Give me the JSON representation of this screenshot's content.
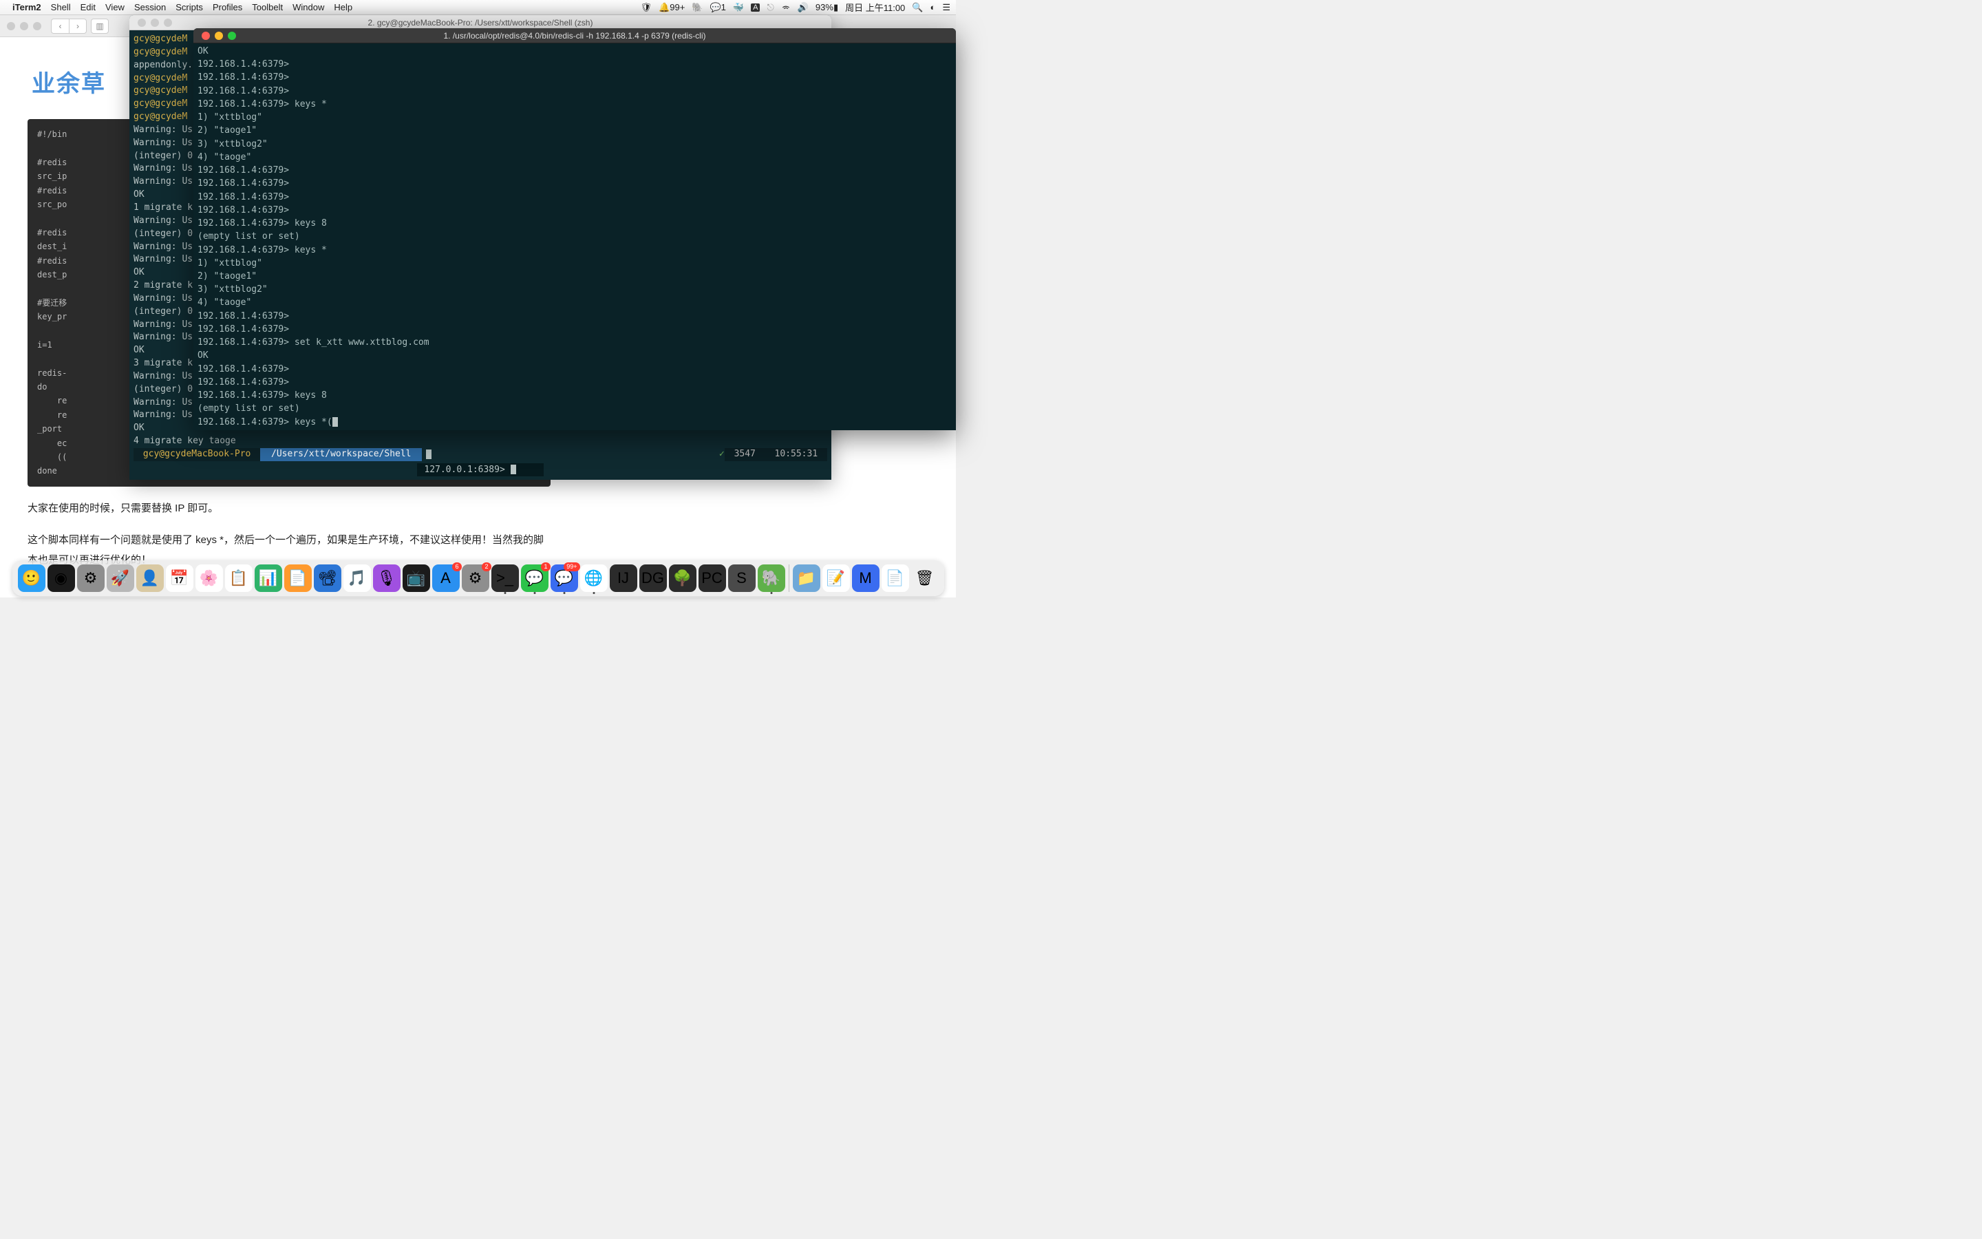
{
  "menubar": {
    "app": "iTerm2",
    "items": [
      "Shell",
      "Edit",
      "View",
      "Session",
      "Scripts",
      "Profiles",
      "Toolbelt",
      "Window",
      "Help"
    ],
    "status": {
      "notif": "99+",
      "wechat": "1",
      "battery": "93%",
      "datetime": "周日 上午11:00"
    }
  },
  "browser": {
    "logo": "业余草",
    "code_lines": [
      "#!/bin",
      "",
      "#redis",
      "src_ip",
      "#redis",
      "src_po",
      "",
      "#redis",
      "dest_i",
      "#redis",
      "dest_p",
      "",
      "#要迁移",
      "key_pr",
      "",
      "i=1",
      "",
      "redis-",
      "do",
      "    re",
      "    re",
      "_port ",
      "    ec",
      "    ((",
      "done"
    ],
    "para1": "大家在使用的时候，只需要替换 IP 即可。",
    "para2": "这个脚本同样有一个问题就是使用了 keys *，然后一个一个遍历，如果是生产环境，不建议这样使用！当然我的脚本也是可以再进行优化的！"
  },
  "term1": {
    "title": "2. gcy@gcydeMacBook-Pro: /Users/xtt/workspace/Shell (zsh)",
    "prompt_user": "gcy@gcydeM",
    "left_lines": [
      "gcy@gcydeM",
      "gcy@gcydeM",
      "appendonly.",
      "gcy@gcydeM",
      "gcy@gcydeM",
      "gcy@gcydeM",
      "gcy@gcydeM",
      "Warning: Us",
      "Warning: Us",
      "(integer) 0",
      "Warning: Us",
      "Warning: Us",
      "OK",
      "1 migrate k",
      "Warning: Us",
      "(integer) 0",
      "Warning: Us",
      "Warning: Us",
      "OK",
      "2 migrate k",
      "Warning: Us",
      "(integer) 0",
      "Warning: Us",
      "Warning: Us",
      "OK",
      "3 migrate k",
      "Warning: Us",
      "(integer) 0",
      "Warning: Us",
      "Warning: Us",
      "OK",
      "4 migrate key taoge"
    ],
    "bottom_prompt_user": "gcy@gcydeMacBook-Pro",
    "bottom_prompt_path": "/Users/xtt/workspace/Shell",
    "right_num": "3547",
    "right_time": "10:55:31",
    "local_prompt": "127.0.0.1:6389> "
  },
  "term2": {
    "title": "1. /usr/local/opt/redis@4.0/bin/redis-cli -h 192.168.1.4 -p 6379 (redis-cli)",
    "lines": [
      "OK",
      "192.168.1.4:6379>",
      "192.168.1.4:6379>",
      "192.168.1.4:6379>",
      "192.168.1.4:6379> keys *",
      "1) \"xttblog\"",
      "2) \"taoge1\"",
      "3) \"xttblog2\"",
      "4) \"taoge\"",
      "192.168.1.4:6379>",
      "192.168.1.4:6379>",
      "192.168.1.4:6379>",
      "192.168.1.4:6379>",
      "192.168.1.4:6379> keys 8",
      "(empty list or set)",
      "192.168.1.4:6379> keys *",
      "1) \"xttblog\"",
      "2) \"taoge1\"",
      "3) \"xttblog2\"",
      "4) \"taoge\"",
      "192.168.1.4:6379>",
      "192.168.1.4:6379>",
      "192.168.1.4:6379> set k_xtt www.xttblog.com",
      "OK",
      "192.168.1.4:6379>",
      "192.168.1.4:6379>",
      "192.168.1.4:6379> keys 8",
      "(empty list or set)",
      "192.168.1.4:6379> keys *("
    ]
  },
  "dock": {
    "apps": [
      {
        "name": "finder",
        "bg": "#2aa0f5",
        "glyph": "🙂"
      },
      {
        "name": "siri",
        "bg": "#1b1b1b",
        "glyph": "◉"
      },
      {
        "name": "sysprefs",
        "bg": "#8e8e8e",
        "glyph": "⚙"
      },
      {
        "name": "launchpad",
        "bg": "#b8b8b8",
        "glyph": "🚀"
      },
      {
        "name": "contacts",
        "bg": "#d9c9a3",
        "glyph": "👤"
      },
      {
        "name": "calendar",
        "bg": "#ffffff",
        "glyph": "📅"
      },
      {
        "name": "photos",
        "bg": "#ffffff",
        "glyph": "🌸"
      },
      {
        "name": "reminders",
        "bg": "#ffffff",
        "glyph": "📋"
      },
      {
        "name": "numbers",
        "bg": "#2fb36a",
        "glyph": "📊"
      },
      {
        "name": "pages",
        "bg": "#ff9a2e",
        "glyph": "📄"
      },
      {
        "name": "keynote",
        "bg": "#2c76d6",
        "glyph": "📽"
      },
      {
        "name": "music",
        "bg": "#ffffff",
        "glyph": "🎵"
      },
      {
        "name": "podcasts",
        "bg": "#a050e0",
        "glyph": "🎙"
      },
      {
        "name": "tv",
        "bg": "#1b1b1b",
        "glyph": "📺"
      },
      {
        "name": "appstore",
        "bg": "#2a90f0",
        "glyph": "A",
        "badge": "6"
      },
      {
        "name": "sysprefs2",
        "bg": "#8e8e8e",
        "glyph": "⚙",
        "badge": "2"
      },
      {
        "name": "iterm",
        "bg": "#2b2b2b",
        "glyph": ">_",
        "dot": true
      },
      {
        "name": "wechat",
        "bg": "#2dc24a",
        "glyph": "💬",
        "badge": "1",
        "dot": true
      },
      {
        "name": "wechatwork",
        "bg": "#3a6cf0",
        "glyph": "💬",
        "badge": "99+",
        "dot": true
      },
      {
        "name": "chrome",
        "bg": "#ffffff",
        "glyph": "🌐",
        "dot": true
      },
      {
        "name": "intellij",
        "bg": "#2b2b2b",
        "glyph": "IJ"
      },
      {
        "name": "datagrip",
        "bg": "#2b2b2b",
        "glyph": "DG"
      },
      {
        "name": "gitkraken",
        "bg": "#2b2b2b",
        "glyph": "🌳"
      },
      {
        "name": "pycharm",
        "bg": "#2b2b2b",
        "glyph": "PC"
      },
      {
        "name": "sublime",
        "bg": "#4a4a4a",
        "glyph": "S"
      },
      {
        "name": "evernote",
        "bg": "#5fb04a",
        "glyph": "🐘",
        "dot": true
      }
    ],
    "right": [
      {
        "name": "folder",
        "bg": "#6fa8d8",
        "glyph": "📁"
      },
      {
        "name": "notes",
        "bg": "#ffffff",
        "glyph": "📝"
      },
      {
        "name": "mweb",
        "bg": "#3a6cf0",
        "glyph": "M"
      },
      {
        "name": "textedit",
        "bg": "#ffffff",
        "glyph": "📄"
      },
      {
        "name": "trash",
        "bg": "transparent",
        "glyph": "🗑"
      }
    ]
  }
}
